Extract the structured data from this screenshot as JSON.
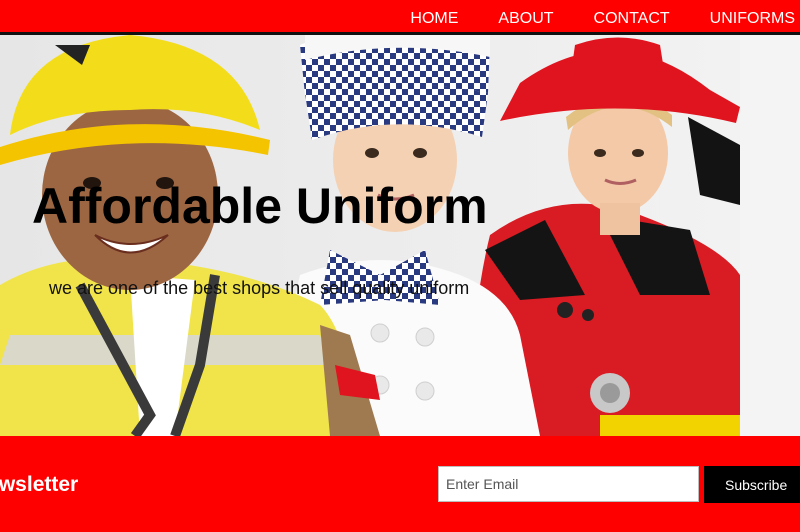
{
  "nav": {
    "items": [
      {
        "label": "HOME"
      },
      {
        "label": "ABOUT"
      },
      {
        "label": "CONTACT"
      },
      {
        "label": "UNIFORMS"
      }
    ]
  },
  "hero": {
    "title": "Affordable Uniform",
    "tagline": "we are one of the best shops that sell quality uniform",
    "image": "kids-in-uniforms-photo"
  },
  "newsletter": {
    "title": "Newsletter",
    "email_placeholder": "Enter Email",
    "subscribe_label": "Subscribe"
  },
  "colors": {
    "brand_red": "#ff0000",
    "nav_border": "#111111",
    "button_bg": "#000000",
    "text_white": "#ffffff"
  }
}
